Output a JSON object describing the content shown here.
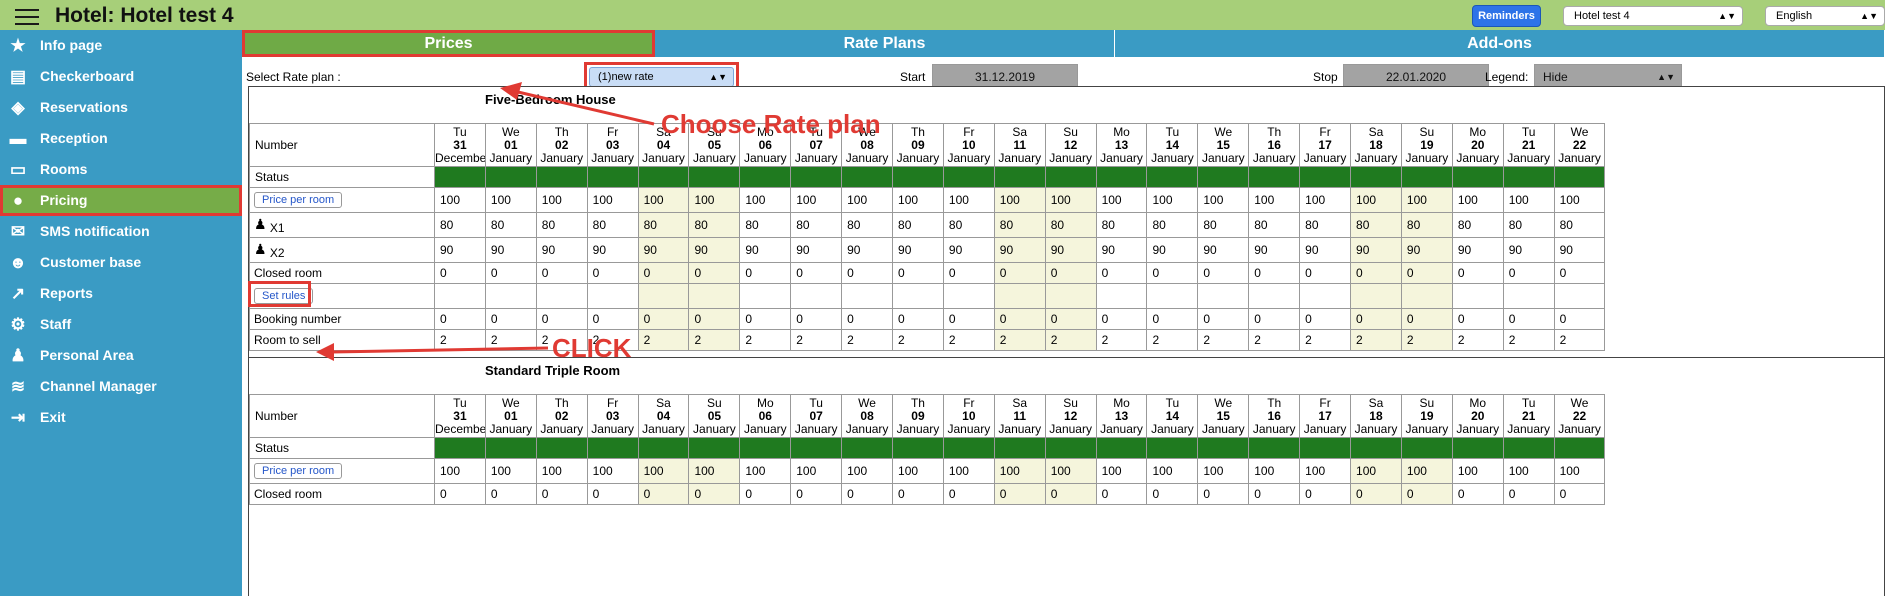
{
  "header": {
    "title": "Hotel: Hotel test 4",
    "reminders_label": "Reminders",
    "hotel_select": "Hotel test 4",
    "language_select": "English"
  },
  "sidebar": {
    "items": [
      {
        "label": "Info page",
        "icon": "star-icon"
      },
      {
        "label": "Checkerboard",
        "icon": "checkerboard-icon"
      },
      {
        "label": "Reservations",
        "icon": "ticket-icon"
      },
      {
        "label": "Reception",
        "icon": "reception-icon"
      },
      {
        "label": "Rooms",
        "icon": "bed-icon"
      },
      {
        "label": "Pricing",
        "icon": "money-bag-icon",
        "active": true
      },
      {
        "label": "SMS notification",
        "icon": "sms-icon"
      },
      {
        "label": "Customer base",
        "icon": "customer-icon"
      },
      {
        "label": "Reports",
        "icon": "chart-icon"
      },
      {
        "label": "Staff",
        "icon": "gear-icon"
      },
      {
        "label": "Personal Area",
        "icon": "person-icon"
      },
      {
        "label": "Channel Manager",
        "icon": "channel-icon"
      },
      {
        "label": "Exit",
        "icon": "exit-icon"
      }
    ]
  },
  "tabs": [
    {
      "label": "Prices",
      "active": true
    },
    {
      "label": "Rate Plans"
    },
    {
      "label": "Add-ons"
    }
  ],
  "toolbar": {
    "rate_plan_label": "Select Rate plan :",
    "rate_plan_value": "(1)new rate",
    "start_label": "Start",
    "start_value": "31.12.2019",
    "stop_label": "Stop",
    "stop_value": "22.01.2020",
    "legend_label": "Legend:",
    "legend_value": "Hide"
  },
  "days": [
    {
      "wd": "Tu",
      "d": "31",
      "m": "December",
      "weekend": false
    },
    {
      "wd": "We",
      "d": "01",
      "m": "January",
      "weekend": false
    },
    {
      "wd": "Th",
      "d": "02",
      "m": "January",
      "weekend": false
    },
    {
      "wd": "Fr",
      "d": "03",
      "m": "January",
      "weekend": false
    },
    {
      "wd": "Sa",
      "d": "04",
      "m": "January",
      "weekend": true
    },
    {
      "wd": "Su",
      "d": "05",
      "m": "January",
      "weekend": true
    },
    {
      "wd": "Mo",
      "d": "06",
      "m": "January",
      "weekend": false
    },
    {
      "wd": "Tu",
      "d": "07",
      "m": "January",
      "weekend": false
    },
    {
      "wd": "We",
      "d": "08",
      "m": "January",
      "weekend": false
    },
    {
      "wd": "Th",
      "d": "09",
      "m": "January",
      "weekend": false
    },
    {
      "wd": "Fr",
      "d": "10",
      "m": "January",
      "weekend": false
    },
    {
      "wd": "Sa",
      "d": "11",
      "m": "January",
      "weekend": true
    },
    {
      "wd": "Su",
      "d": "12",
      "m": "January",
      "weekend": true
    },
    {
      "wd": "Mo",
      "d": "13",
      "m": "January",
      "weekend": false
    },
    {
      "wd": "Tu",
      "d": "14",
      "m": "January",
      "weekend": false
    },
    {
      "wd": "We",
      "d": "15",
      "m": "January",
      "weekend": false
    },
    {
      "wd": "Th",
      "d": "16",
      "m": "January",
      "weekend": false
    },
    {
      "wd": "Fr",
      "d": "17",
      "m": "January",
      "weekend": false
    },
    {
      "wd": "Sa",
      "d": "18",
      "m": "January",
      "weekend": true
    },
    {
      "wd": "Su",
      "d": "19",
      "m": "January",
      "weekend": true
    },
    {
      "wd": "Mo",
      "d": "20",
      "m": "January",
      "weekend": false
    },
    {
      "wd": "Tu",
      "d": "21",
      "m": "January",
      "weekend": false
    },
    {
      "wd": "We",
      "d": "22",
      "m": "January",
      "weekend": false
    }
  ],
  "rooms": [
    {
      "title": "Five-Bedroom House",
      "number_label": "Number",
      "status_label": "Status",
      "rows": [
        {
          "type": "button",
          "label": "Price per room",
          "value": "100"
        },
        {
          "type": "person",
          "label": "X1",
          "value": "80"
        },
        {
          "type": "person",
          "label": "X2",
          "value": "90"
        },
        {
          "type": "text",
          "label": "Closed room",
          "value": "0"
        },
        {
          "type": "rules",
          "label": "Set rules",
          "value": ""
        },
        {
          "type": "text",
          "label": "Booking number",
          "value": "0"
        },
        {
          "type": "text",
          "label": "Room to sell",
          "value": "2"
        }
      ]
    },
    {
      "title": "Standard Triple Room",
      "number_label": "Number",
      "status_label": "Status",
      "rows": [
        {
          "type": "button",
          "label": "Price per room",
          "value": "100"
        },
        {
          "type": "text",
          "label": "Closed room",
          "value": "0"
        }
      ]
    }
  ],
  "annotations": {
    "choose_rate_plan": "Choose Rate plan",
    "click": "CLICK",
    "color": "#e03a33"
  },
  "colors": {
    "header_green": "#a7cf79",
    "sidebar_blue": "#3a9bc4",
    "active_green": "#76ac48",
    "status_green": "#1f7a1f",
    "weekend_bg": "#f5f5dc",
    "highlight_red": "#e03a33"
  }
}
